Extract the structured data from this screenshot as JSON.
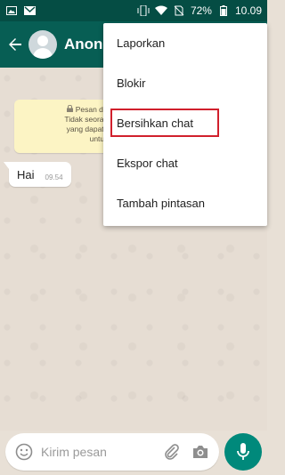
{
  "status_bar": {
    "battery_percent": "72%",
    "time": "10.09",
    "icons": [
      "image-icon",
      "gmail-icon",
      "vibrate-icon",
      "wifi-icon",
      "no-sim-icon",
      "battery-icon"
    ]
  },
  "header": {
    "contact_name": "Anonim",
    "icons": [
      "back-arrow-icon",
      "avatar-icon"
    ]
  },
  "chat": {
    "encryption_notice": {
      "lines": [
        "Pesan dan pang",
        "Tidak seorang pun d",
        "yang dapat memba",
        "untuk"
      ]
    },
    "messages": [
      {
        "text": "Hai",
        "time": "09.54"
      }
    ]
  },
  "menu": {
    "items": [
      {
        "label": "Laporkan"
      },
      {
        "label": "Blokir"
      },
      {
        "label": "Bersihkan chat"
      },
      {
        "label": "Ekspor chat"
      },
      {
        "label": "Tambah pintasan"
      }
    ],
    "highlight_item": "Bersihkan chat",
    "highlight_color": "#d1202c"
  },
  "composer": {
    "placeholder": "Kirim pesan",
    "icons": [
      "emoji-icon",
      "attach-icon",
      "camera-icon",
      "mic-icon"
    ]
  },
  "colors": {
    "app_bar": "#075e54",
    "status_bar": "#054d44",
    "mic_button": "#00897b",
    "notice_bg": "#fcf4c4"
  }
}
